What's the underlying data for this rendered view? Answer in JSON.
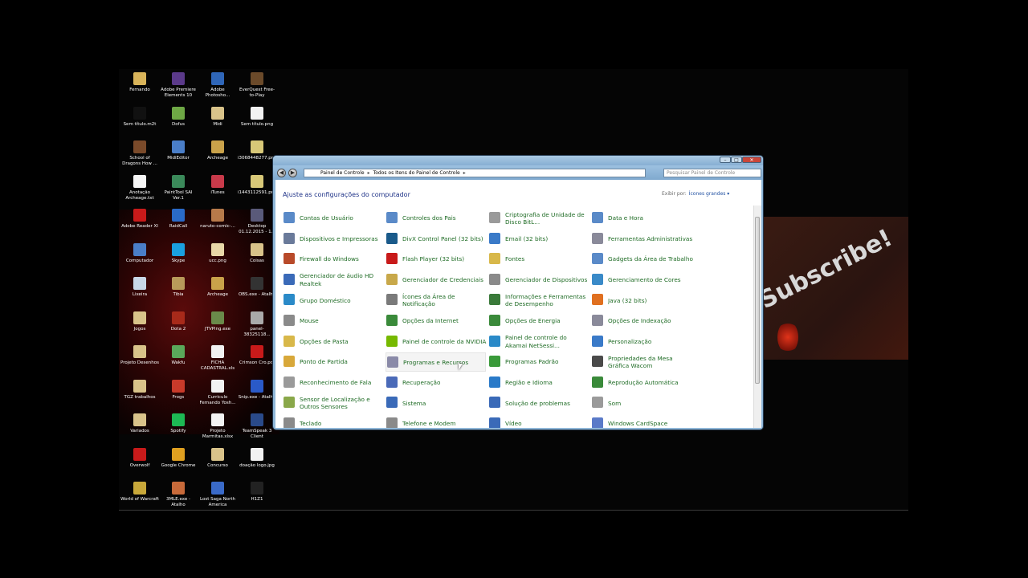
{
  "desktop_icons": [
    {
      "label": "Fernando",
      "color": "#d9b45a"
    },
    {
      "label": "Adobe Premiere Elements 10",
      "color": "#5b3a8a"
    },
    {
      "label": "Adobe Photosho...",
      "color": "#2f66b8"
    },
    {
      "label": "EverQuest Free-to-Play",
      "color": "#6b4a2a"
    },
    {
      "label": "Sem título.m2t",
      "color": "#111111"
    },
    {
      "label": "Dofus",
      "color": "#6ea845"
    },
    {
      "label": "Midi",
      "color": "#d9c38a"
    },
    {
      "label": "Sem título.png",
      "color": "#f2f2f2"
    },
    {
      "label": "School of Dragons How ...",
      "color": "#7a4a2a"
    },
    {
      "label": "MidiEditor",
      "color": "#4a7ec8"
    },
    {
      "label": "Archeage",
      "color": "#c9a24a"
    },
    {
      "label": "i3068448277.png",
      "color": "#d8c878"
    },
    {
      "label": "Anotação Archeage.txt",
      "color": "#f6f6f6"
    },
    {
      "label": "PaintTool SAI Ver.1",
      "color": "#3b8a5a"
    },
    {
      "label": "iTunes",
      "color": "#c83a4a"
    },
    {
      "label": "i1443112591.png",
      "color": "#d8c878"
    },
    {
      "label": "Adobe Reader XI",
      "color": "#c81a1a"
    },
    {
      "label": "RaidCall",
      "color": "#2a6ac8"
    },
    {
      "label": "naruto-comic-...",
      "color": "#b87a4a"
    },
    {
      "label": "Desktop 01.12.2015 - 1...",
      "color": "#5a5a7a"
    },
    {
      "label": "Computador",
      "color": "#4a7ec8"
    },
    {
      "label": "Skype",
      "color": "#1aa0e0"
    },
    {
      "label": "ucc.png",
      "color": "#e8d8a8"
    },
    {
      "label": "Coisas",
      "color": "#d9c38a"
    },
    {
      "label": "Lixeira",
      "color": "#c8d8e8"
    },
    {
      "label": "Tibia",
      "color": "#b89a5a"
    },
    {
      "label": "Archeage",
      "color": "#c9a24a"
    },
    {
      "label": "OBS.exe - Atalho",
      "color": "#333333"
    },
    {
      "label": "Jogos",
      "color": "#d9c38a"
    },
    {
      "label": "Dota 2",
      "color": "#a82a1a"
    },
    {
      "label": "JTVPing.exe",
      "color": "#6a8a4a"
    },
    {
      "label": "panel-38325118...",
      "color": "#aaaaaa"
    },
    {
      "label": "Projeto Desenhos",
      "color": "#d9c38a"
    },
    {
      "label": "Wakfu",
      "color": "#5aa85a"
    },
    {
      "label": "FICHA CADASTRAL.xls",
      "color": "#f2f2f2"
    },
    {
      "label": "Crimson Cro.pdf",
      "color": "#c81a1a"
    },
    {
      "label": "TGZ trabalhos",
      "color": "#d9c38a"
    },
    {
      "label": "Frogs",
      "color": "#c83a2a"
    },
    {
      "label": "Curriculo Fernando Yosh...",
      "color": "#f2f2f2"
    },
    {
      "label": "Snip.exe - Atalho",
      "color": "#2a5ac8"
    },
    {
      "label": "Variados",
      "color": "#d9c38a"
    },
    {
      "label": "Spotify",
      "color": "#1db954"
    },
    {
      "label": "Projeto Marmitas.xlsx",
      "color": "#f2f2f2"
    },
    {
      "label": "TeamSpeak 3 Client",
      "color": "#2a4a8a"
    },
    {
      "label": "Overwolf",
      "color": "#c81a1a"
    },
    {
      "label": "Google Chrome",
      "color": "#e0a020"
    },
    {
      "label": "Concurso",
      "color": "#d9c38a"
    },
    {
      "label": "doação logo.jpg",
      "color": "#f2f2f2"
    },
    {
      "label": "World of Warcraft",
      "color": "#c8a83a"
    },
    {
      "label": "3MLE.exe - Atalho",
      "color": "#c86a3a"
    },
    {
      "label": "Lost Saga North America",
      "color": "#3a6ac8"
    },
    {
      "label": "H1Z1",
      "color": "#222222"
    }
  ],
  "banner": {
    "text": "Subscribe!"
  },
  "window": {
    "title_buttons": {
      "minimize": "–",
      "maximize": "□",
      "close": "✕"
    },
    "breadcrumb": [
      "Painel de Controle",
      "Todos os Itens do Painel de Controle"
    ],
    "search_placeholder": "Pesquisar Painel de Controle",
    "content_title": "Ajuste as configurações do computador",
    "view_by_label": "Exibir por:",
    "view_by_value": "Ícones grandes ▾",
    "columns": [
      [
        {
          "label": "Contas de Usuário",
          "color": "#5a8ac8"
        },
        {
          "label": "Dispositivos e Impressoras",
          "color": "#6a7a9a"
        },
        {
          "label": "Firewall do Windows",
          "color": "#b84a2a"
        },
        {
          "label": "Gerenciador de áudio HD Realtek",
          "color": "#3a6ab8"
        },
        {
          "label": "Grupo Doméstico",
          "color": "#2a8ac8"
        },
        {
          "label": "Mouse",
          "color": "#8a8a8a"
        },
        {
          "label": "Opções de Pasta",
          "color": "#d8b84a"
        },
        {
          "label": "Ponto de Partida",
          "color": "#d8a83a"
        },
        {
          "label": "Reconhecimento de Fala",
          "color": "#9a9a9a"
        },
        {
          "label": "Sensor de Localização e Outros Sensores",
          "color": "#8aa84a"
        },
        {
          "label": "Teclado",
          "color": "#8a8a8a"
        }
      ],
      [
        {
          "label": "Controles dos Pais",
          "color": "#5a8ac8"
        },
        {
          "label": "DivX Control Panel (32 bits)",
          "color": "#1a5a8a"
        },
        {
          "label": "Flash Player (32 bits)",
          "color": "#c81a1a"
        },
        {
          "label": "Gerenciador de Credenciais",
          "color": "#c8a84a"
        },
        {
          "label": "Ícones da Área de Notificação",
          "color": "#7a7a7a"
        },
        {
          "label": "Opções da Internet",
          "color": "#3a8a3a"
        },
        {
          "label": "Painel de controle da NVIDIA",
          "color": "#76b900"
        },
        {
          "label": "Programas e Recursos",
          "color": "#8a8aa8"
        },
        {
          "label": "Recuperação",
          "color": "#4a6ab8"
        },
        {
          "label": "Sistema",
          "color": "#3a6ab8"
        },
        {
          "label": "Telefone e Modem",
          "color": "#8a8a8a"
        }
      ],
      [
        {
          "label": "Criptografia de Unidade de Disco BitL...",
          "color": "#9a9a9a"
        },
        {
          "label": "Email (32 bits)",
          "color": "#3a7ac8"
        },
        {
          "label": "Fontes",
          "color": "#d8b84a"
        },
        {
          "label": "Gerenciador de Dispositivos",
          "color": "#8a8a8a"
        },
        {
          "label": "Informações e Ferramentas de Desempenho",
          "color": "#3a7a3a"
        },
        {
          "label": "Opções de Energia",
          "color": "#3a8a3a"
        },
        {
          "label": "Painel de controle do Akamai NetSessi...",
          "color": "#2a8ac8"
        },
        {
          "label": "Programas Padrão",
          "color": "#3a9a3a"
        },
        {
          "label": "Região e Idioma",
          "color": "#2a7ac8"
        },
        {
          "label": "Solução de problemas",
          "color": "#3a6ab8"
        },
        {
          "label": "Vídeo",
          "color": "#3a6ab8"
        }
      ],
      [
        {
          "label": "Data e Hora",
          "color": "#5a8ac8"
        },
        {
          "label": "Ferramentas Administrativas",
          "color": "#8a8a9a"
        },
        {
          "label": "Gadgets da Área de Trabalho",
          "color": "#5a8ac8"
        },
        {
          "label": "Gerenciamento de Cores",
          "color": "#3a8ac8"
        },
        {
          "label": "Java (32 bits)",
          "color": "#e07020"
        },
        {
          "label": "Opções de Indexação",
          "color": "#8a8a9a"
        },
        {
          "label": "Personalização",
          "color": "#3a7ac8"
        },
        {
          "label": "Propriedades da Mesa Gráfica Wacom",
          "color": "#4a4a4a"
        },
        {
          "label": "Reprodução Automática",
          "color": "#3a8a3a"
        },
        {
          "label": "Som",
          "color": "#9a9a9a"
        },
        {
          "label": "Windows CardSpace",
          "color": "#5a7ac8"
        }
      ]
    ]
  }
}
